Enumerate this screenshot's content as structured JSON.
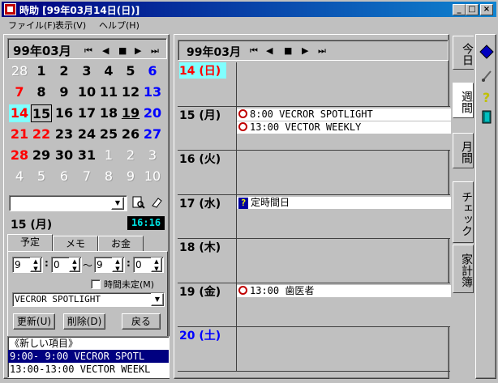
{
  "window": {
    "title": "時助 [99年03月14日(日)]",
    "accent": "#000080"
  },
  "window_buttons": {
    "minimize": "_",
    "maximize": "□",
    "close": "×"
  },
  "menu": {
    "file": "ファイル(F)",
    "view": "表示(V)",
    "help": "ヘルプ(H)"
  },
  "calendar": {
    "month": "99年03月",
    "nav": [
      "⏮",
      "◀",
      "■",
      "▶",
      "⏭"
    ],
    "weeks": [
      [
        {
          "d": "28",
          "c": "gray"
        },
        {
          "d": "1",
          "c": "n"
        },
        {
          "d": "2",
          "c": "n"
        },
        {
          "d": "3",
          "c": "n"
        },
        {
          "d": "4",
          "c": "n"
        },
        {
          "d": "5",
          "c": "n"
        },
        {
          "d": "6",
          "c": "sat"
        }
      ],
      [
        {
          "d": "7",
          "c": "sun"
        },
        {
          "d": "8",
          "c": "n"
        },
        {
          "d": "9",
          "c": "n"
        },
        {
          "d": "10",
          "c": "n"
        },
        {
          "d": "11",
          "c": "n"
        },
        {
          "d": "12",
          "c": "n"
        },
        {
          "d": "13",
          "c": "sat"
        }
      ],
      [
        {
          "d": "14",
          "c": "today"
        },
        {
          "d": "15",
          "c": "box"
        },
        {
          "d": "16",
          "c": "n"
        },
        {
          "d": "17",
          "c": "n"
        },
        {
          "d": "18",
          "c": "n"
        },
        {
          "d": "19",
          "c": "under"
        },
        {
          "d": "20",
          "c": "sat"
        }
      ],
      [
        {
          "d": "21",
          "c": "sun"
        },
        {
          "d": "22",
          "c": "sun"
        },
        {
          "d": "23",
          "c": "n"
        },
        {
          "d": "24",
          "c": "n"
        },
        {
          "d": "25",
          "c": "n"
        },
        {
          "d": "26",
          "c": "n"
        },
        {
          "d": "27",
          "c": "sat"
        }
      ],
      [
        {
          "d": "28",
          "c": "sun"
        },
        {
          "d": "29",
          "c": "n"
        },
        {
          "d": "30",
          "c": "n"
        },
        {
          "d": "31",
          "c": "n"
        },
        {
          "d": "1",
          "c": "gray"
        },
        {
          "d": "2",
          "c": "gray"
        },
        {
          "d": "3",
          "c": "gray"
        }
      ],
      [
        {
          "d": "4",
          "c": "gray"
        },
        {
          "d": "5",
          "c": "gray"
        },
        {
          "d": "6",
          "c": "gray"
        },
        {
          "d": "7",
          "c": "gray"
        },
        {
          "d": "8",
          "c": "gray"
        },
        {
          "d": "9",
          "c": "gray"
        },
        {
          "d": "10",
          "c": "gray"
        }
      ]
    ]
  },
  "memo_field": {
    "value": ""
  },
  "selected_date": "15 (月)",
  "clock": "16:16",
  "tabs": {
    "schedule": "予定",
    "memo": "メモ",
    "money": "お金"
  },
  "editor": {
    "start_hour": "9",
    "start_min": "0",
    "tilde": "～",
    "end_hour": "9",
    "end_min": "0",
    "colon": ":",
    "time_undecided": "時間未定(M)",
    "title_value": "VECROR SPOTLIGHT",
    "update": "更新(U)",
    "delete": "削除(D)",
    "back": "戻る"
  },
  "list": {
    "items": [
      "《新しい項目》",
      " 9:00- 9:00 VECROR SPOTL",
      "13:00-13:00 VECTOR WEEKL"
    ]
  },
  "week": {
    "month": "99年03月",
    "nav": [
      "⏮",
      "◀",
      "■",
      "▶",
      "⏭"
    ],
    "days": [
      {
        "label": "14 (日)",
        "entries": []
      },
      {
        "label": "15 (月)",
        "entries": [
          "8:00 VECROR SPOTLIGHT",
          "13:00 VECTOR WEEKLY"
        ]
      },
      {
        "label": "16 (火)",
        "entries": []
      },
      {
        "label": "17 (水)",
        "entries": [
          "定時間日"
        ]
      },
      {
        "label": "18 (木)",
        "entries": []
      },
      {
        "label": "19 (金)",
        "entries": [
          "13:00 歯医者"
        ]
      },
      {
        "label": "20 (土)",
        "entries": []
      }
    ]
  },
  "vtabs": {
    "today": "今日",
    "week": "週間",
    "month": "月間",
    "check": "チェック",
    "budget": "家計簿"
  },
  "colors": {
    "sunday": "#ff0000",
    "saturday": "#0000ff",
    "today_bg": "#80ffff",
    "today_fg": "#ff0000"
  }
}
